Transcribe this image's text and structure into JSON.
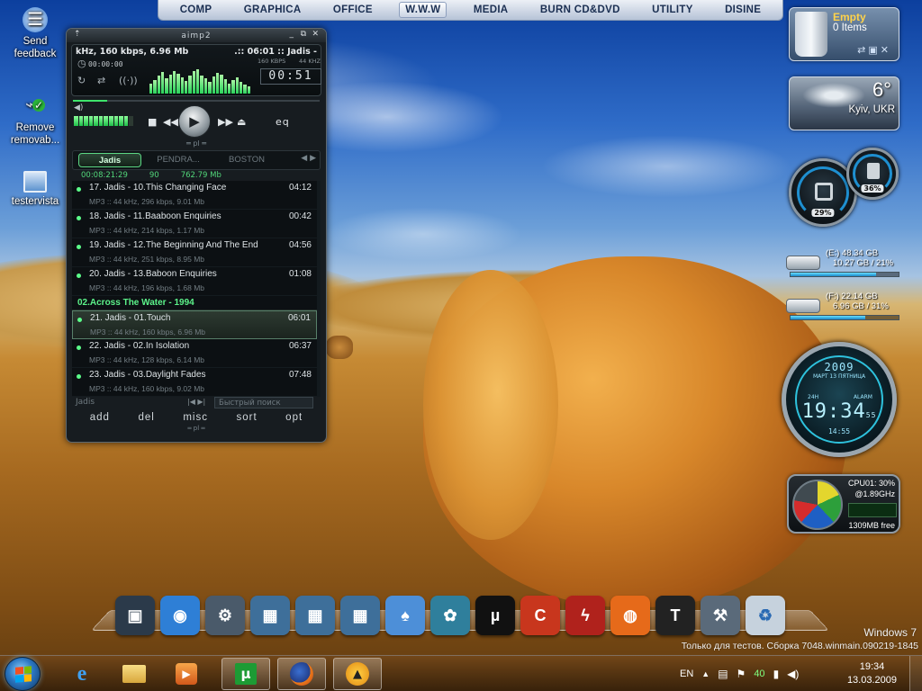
{
  "top_menu": [
    "COMP",
    "GRAPHICA",
    "OFFICE",
    "W.W.W",
    "MEDIA",
    "BURN CD&DVD",
    "UTILITY",
    "DISINE"
  ],
  "desktop_icons": [
    {
      "label": "Send feedback",
      "icon": "feedback-icon"
    },
    {
      "label": "Remove removab...",
      "icon": "usb-remove-icon"
    },
    {
      "label": "testervista",
      "icon": "computer-icon"
    }
  ],
  "aimp": {
    "title": "aimp2",
    "track_info": "kHz, 160 kbps, 6.96 Mb",
    "track_time": ".:: 06:01 :: Jadis -",
    "kbps": "160 KBPS",
    "khz": "44 KHZ",
    "elapsed": "00:00:00",
    "time_display": "00:51",
    "progress": 0.14,
    "volume": 0.9,
    "eq_label": "eq",
    "tabs": [
      "Jadis",
      "PENDRA...",
      "BOSTON"
    ],
    "active_tab": "Jadis",
    "stats": {
      "duration": "00:08:21:29",
      "count": "90",
      "size": "762.79 Mb"
    },
    "playlist": [
      {
        "type": "track",
        "title": "17. Jadis - 10.This Changing Face",
        "duration": "04:12",
        "meta": "MP3 :: 44 kHz, 296 kbps, 9.01 Mb"
      },
      {
        "type": "track",
        "title": "18. Jadis - 11.Baaboon Enquiries",
        "duration": "00:42",
        "meta": "MP3 :: 44 kHz, 214 kbps, 1.17 Mb"
      },
      {
        "type": "track",
        "title": "19. Jadis - 12.The Beginning And The End",
        "duration": "04:56",
        "meta": "MP3 :: 44 kHz, 251 kbps, 8.95 Mb"
      },
      {
        "type": "track",
        "title": "20. Jadis - 13.Baboon Enquiries",
        "duration": "01:08",
        "meta": "MP3 :: 44 kHz, 196 kbps, 1.68 Mb"
      },
      {
        "type": "group",
        "title": "02.Across The Water - 1994"
      },
      {
        "type": "track",
        "title": "21. Jadis - 01.Touch",
        "duration": "06:01",
        "meta": "MP3 :: 44 kHz, 160 kbps, 6.96 Mb",
        "current": true
      },
      {
        "type": "track",
        "title": "22. Jadis - 02.In Isolation",
        "duration": "06:37",
        "meta": "MP3 :: 44 kHz, 128 kbps, 6.14 Mb"
      },
      {
        "type": "track",
        "title": "23. Jadis - 03.Daylight Fades",
        "duration": "07:48",
        "meta": "MP3 :: 44 kHz, 160 kbps, 9.02 Mb"
      }
    ],
    "playlist_name": "Jadis",
    "search_placeholder": "Быстрый поиск",
    "bottom_buttons": [
      "add",
      "del",
      "misc",
      "sort",
      "opt"
    ]
  },
  "gadgets": {
    "recycle_bin": {
      "status": "Empty",
      "items": "0 Items"
    },
    "weather": {
      "temp": "6°",
      "city": "Kyiv, UKR"
    },
    "meters": {
      "cpu_pct": "29%",
      "mem_pct": "36%"
    },
    "drives": [
      {
        "line1": "(E:) 48.34 GB",
        "line2": "10.27 GB / 21%",
        "fill": 0.79
      },
      {
        "line1": "(F:) 22.14 GB",
        "line2": "6.96 GB / 31%",
        "fill": 0.69
      }
    ],
    "clock": {
      "year": "2009",
      "date": "МАРТ 13 ПЯТНИЦА",
      "label_left": "24H",
      "label_right": "ALARM",
      "time": "19:34",
      "sec": "55",
      "small": "14:55"
    },
    "cpu": {
      "line1": "CPU01: 30%",
      "line2": "@1.89GHz",
      "free": "1309MB free"
    }
  },
  "dock": [
    {
      "name": "dock-monitor",
      "icon": "monitor-icon",
      "color": "#2b3a4a"
    },
    {
      "name": "dock-network",
      "icon": "globe-icon",
      "color": "#2e7fd6"
    },
    {
      "name": "dock-tools",
      "icon": "tools-icon",
      "color": "#4a5a6a"
    },
    {
      "name": "dock-folder-1",
      "icon": "folder-icon",
      "color": "#3e6f9a"
    },
    {
      "name": "dock-folder-2",
      "icon": "folder-icon",
      "color": "#3e6f9a"
    },
    {
      "name": "dock-folder-3",
      "icon": "folder-icon",
      "color": "#3e6f9a"
    },
    {
      "name": "dock-solitaire",
      "icon": "cards-icon",
      "color": "#4d8fd8"
    },
    {
      "name": "dock-icq",
      "icon": "flower-icon",
      "color": "#2f7f9c"
    },
    {
      "name": "dock-utorrent",
      "icon": "utorrent-icon",
      "color": "#111111"
    },
    {
      "name": "dock-ccleaner",
      "icon": "ccleaner-icon",
      "color": "#c8361d"
    },
    {
      "name": "dock-flashget",
      "icon": "lightning-icon",
      "color": "#b0221c"
    },
    {
      "name": "dock-firefox",
      "icon": "firefox-icon",
      "color": "#e66a1a"
    },
    {
      "name": "dock-tshirt",
      "icon": "tshirt-icon",
      "color": "#222222"
    },
    {
      "name": "dock-settings",
      "icon": "wrench-icon",
      "color": "#5a6a7a"
    },
    {
      "name": "dock-recycle",
      "icon": "recycle-icon",
      "color": "#c6d2dd"
    }
  ],
  "watermark": {
    "line1": "Windows 7",
    "line2": "Только для тестов. Сборка 7048.winmain.090219-1845"
  },
  "taskbar": {
    "items": [
      {
        "name": "taskbar-ie",
        "icon": "ie-icon",
        "open": false
      },
      {
        "name": "taskbar-explorer",
        "icon": "folder-icon",
        "open": false
      },
      {
        "name": "taskbar-mediaplayer",
        "icon": "media-player-icon",
        "open": false
      },
      {
        "name": "taskbar-utorrent",
        "icon": "utorrent-icon",
        "open": true
      },
      {
        "name": "taskbar-firefox",
        "icon": "firefox-icon",
        "open": true
      },
      {
        "name": "taskbar-aimp",
        "icon": "aimp-icon",
        "open": true
      }
    ],
    "lang": "EN",
    "tray_number": "40",
    "time": "19:34",
    "date": "13.03.2009"
  },
  "colors": {
    "accent_green": "#5cf38a",
    "aimp_bg": "#171c20",
    "clock_cyan": "#9ce7ff"
  }
}
